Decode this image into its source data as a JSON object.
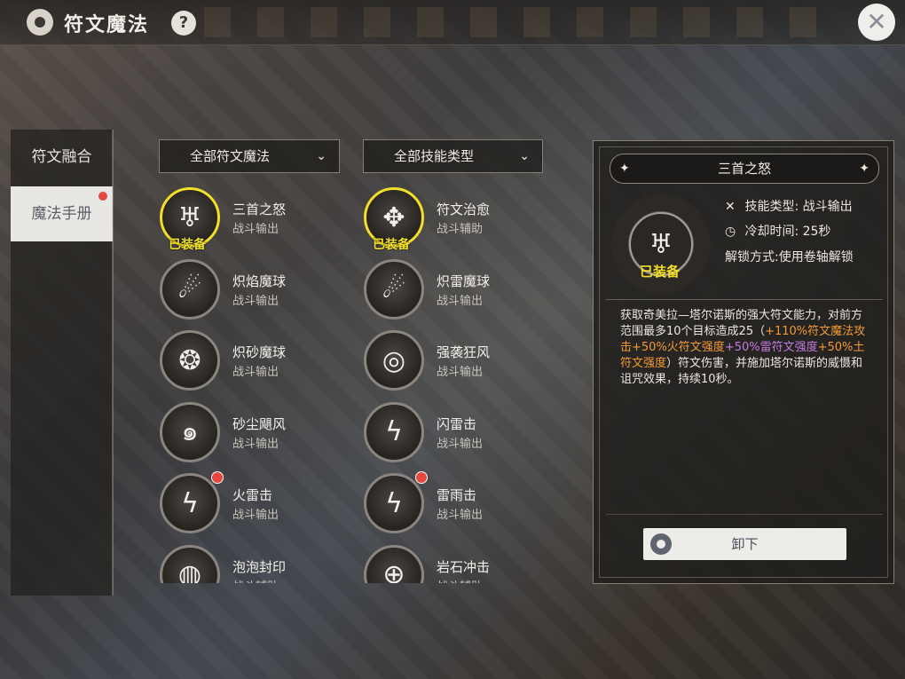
{
  "header": {
    "title": "符文魔法",
    "help_label": "?",
    "close_glyph": "✕"
  },
  "side_tabs": [
    {
      "label": "符文融合"
    },
    {
      "label": "魔法手册",
      "selected": true,
      "has_notification": true
    }
  ],
  "filters": {
    "rune_filter": "全部符文魔法",
    "skill_type_filter": "全部技能类型",
    "chevron": "⌄"
  },
  "skills": [
    {
      "name": "三首之怒",
      "type": "战斗输出",
      "equipped": true,
      "badge": "已装备",
      "icon": "three-heads-icon"
    },
    {
      "name": "符文治愈",
      "type": "战斗辅助",
      "equipped": true,
      "badge": "已装备",
      "icon": "healing-rune-icon"
    },
    {
      "name": "炽焰魔球",
      "type": "战斗输出",
      "icon": "fire-orb-icon"
    },
    {
      "name": "炽雷魔球",
      "type": "战斗输出",
      "icon": "thunder-orb-icon"
    },
    {
      "name": "炽砂魔球",
      "type": "战斗输出",
      "icon": "sand-orb-icon"
    },
    {
      "name": "强袭狂风",
      "type": "战斗输出",
      "icon": "wind-icon"
    },
    {
      "name": "砂尘飓风",
      "type": "战斗输出",
      "icon": "sand-storm-icon"
    },
    {
      "name": "闪雷击",
      "type": "战斗输出",
      "icon": "lightning-icon"
    },
    {
      "name": "火雷击",
      "type": "战斗输出",
      "has_notification": true,
      "icon": "fire-thunder-icon"
    },
    {
      "name": "雷雨击",
      "type": "战斗输出",
      "has_notification": true,
      "icon": "thunderstorm-icon"
    },
    {
      "name": "泡泡封印",
      "type": "战斗辅助",
      "icon": "bubble-seal-icon"
    },
    {
      "name": "岩石冲击",
      "type": "战斗辅助",
      "icon": "rock-impact-icon"
    }
  ],
  "detail": {
    "title": "三首之怒",
    "badge": "已装备",
    "skill_type": "技能类型: 战斗输出",
    "cooldown": "冷却时间: 25秒",
    "unlock": "解锁方式:使用卷轴解锁",
    "desc_parts": [
      {
        "text": "获取奇美拉—塔尔诺斯的强大符文能力，对前方范围最多10个目标造成25（",
        "color": "normal"
      },
      {
        "text": "+110%符文魔法攻击",
        "color": "orange"
      },
      {
        "text": "+50%火符文强度",
        "color": "orange"
      },
      {
        "text": "+50%雷符文强度",
        "color": "purple"
      },
      {
        "text": "+50%土符文强度",
        "color": "orange"
      },
      {
        "text": "）符文伤害，并施加塔尔诺斯的威慑和诅咒效果，持续10秒。",
        "color": "normal"
      }
    ],
    "unequip_label": "卸下"
  },
  "colors": {
    "equipped_yellow": "#f2df2a",
    "notification_red": "#e4483f",
    "bonus_orange": "#f39a34",
    "bonus_purple": "#c77ae0"
  }
}
